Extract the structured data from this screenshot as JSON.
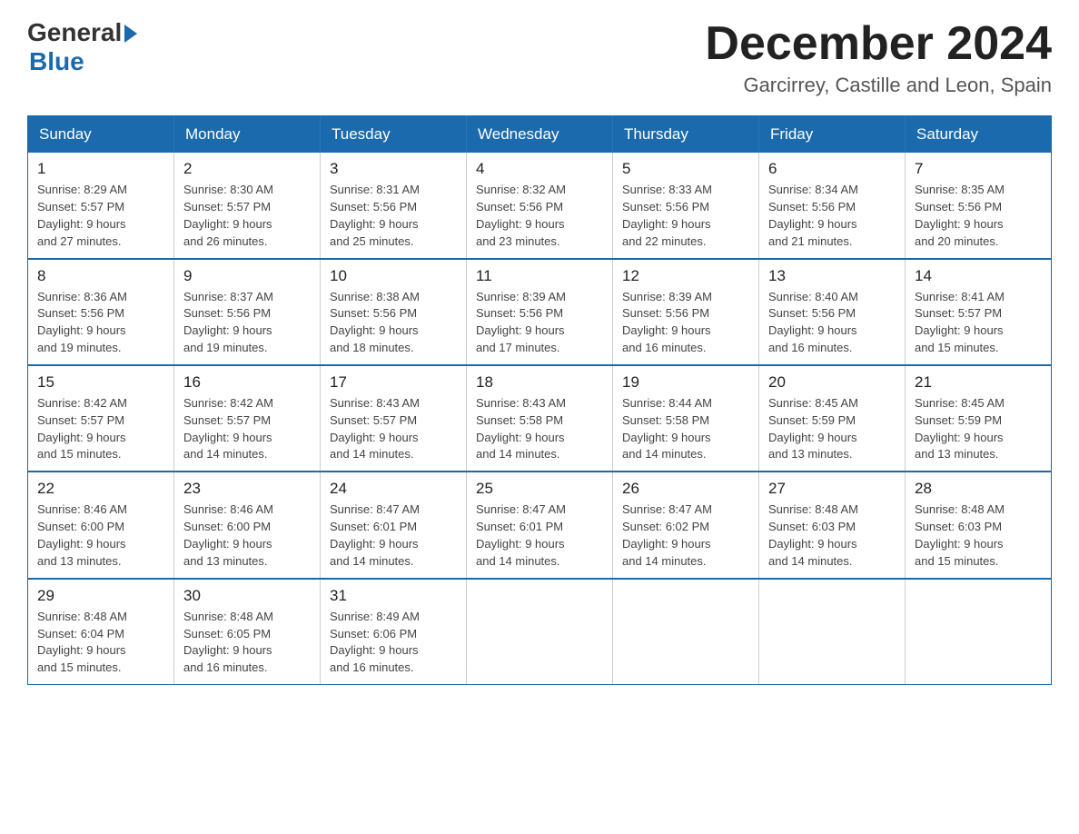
{
  "header": {
    "logo_general": "General",
    "logo_blue": "Blue",
    "month_title": "December 2024",
    "location": "Garcirrey, Castille and Leon, Spain"
  },
  "weekdays": [
    "Sunday",
    "Monday",
    "Tuesday",
    "Wednesday",
    "Thursday",
    "Friday",
    "Saturday"
  ],
  "weeks": [
    [
      {
        "day": "1",
        "sunrise": "8:29 AM",
        "sunset": "5:57 PM",
        "daylight": "9 hours and 27 minutes."
      },
      {
        "day": "2",
        "sunrise": "8:30 AM",
        "sunset": "5:57 PM",
        "daylight": "9 hours and 26 minutes."
      },
      {
        "day": "3",
        "sunrise": "8:31 AM",
        "sunset": "5:56 PM",
        "daylight": "9 hours and 25 minutes."
      },
      {
        "day": "4",
        "sunrise": "8:32 AM",
        "sunset": "5:56 PM",
        "daylight": "9 hours and 23 minutes."
      },
      {
        "day": "5",
        "sunrise": "8:33 AM",
        "sunset": "5:56 PM",
        "daylight": "9 hours and 22 minutes."
      },
      {
        "day": "6",
        "sunrise": "8:34 AM",
        "sunset": "5:56 PM",
        "daylight": "9 hours and 21 minutes."
      },
      {
        "day": "7",
        "sunrise": "8:35 AM",
        "sunset": "5:56 PM",
        "daylight": "9 hours and 20 minutes."
      }
    ],
    [
      {
        "day": "8",
        "sunrise": "8:36 AM",
        "sunset": "5:56 PM",
        "daylight": "9 hours and 19 minutes."
      },
      {
        "day": "9",
        "sunrise": "8:37 AM",
        "sunset": "5:56 PM",
        "daylight": "9 hours and 19 minutes."
      },
      {
        "day": "10",
        "sunrise": "8:38 AM",
        "sunset": "5:56 PM",
        "daylight": "9 hours and 18 minutes."
      },
      {
        "day": "11",
        "sunrise": "8:39 AM",
        "sunset": "5:56 PM",
        "daylight": "9 hours and 17 minutes."
      },
      {
        "day": "12",
        "sunrise": "8:39 AM",
        "sunset": "5:56 PM",
        "daylight": "9 hours and 16 minutes."
      },
      {
        "day": "13",
        "sunrise": "8:40 AM",
        "sunset": "5:56 PM",
        "daylight": "9 hours and 16 minutes."
      },
      {
        "day": "14",
        "sunrise": "8:41 AM",
        "sunset": "5:57 PM",
        "daylight": "9 hours and 15 minutes."
      }
    ],
    [
      {
        "day": "15",
        "sunrise": "8:42 AM",
        "sunset": "5:57 PM",
        "daylight": "9 hours and 15 minutes."
      },
      {
        "day": "16",
        "sunrise": "8:42 AM",
        "sunset": "5:57 PM",
        "daylight": "9 hours and 14 minutes."
      },
      {
        "day": "17",
        "sunrise": "8:43 AM",
        "sunset": "5:57 PM",
        "daylight": "9 hours and 14 minutes."
      },
      {
        "day": "18",
        "sunrise": "8:43 AM",
        "sunset": "5:58 PM",
        "daylight": "9 hours and 14 minutes."
      },
      {
        "day": "19",
        "sunrise": "8:44 AM",
        "sunset": "5:58 PM",
        "daylight": "9 hours and 14 minutes."
      },
      {
        "day": "20",
        "sunrise": "8:45 AM",
        "sunset": "5:59 PM",
        "daylight": "9 hours and 13 minutes."
      },
      {
        "day": "21",
        "sunrise": "8:45 AM",
        "sunset": "5:59 PM",
        "daylight": "9 hours and 13 minutes."
      }
    ],
    [
      {
        "day": "22",
        "sunrise": "8:46 AM",
        "sunset": "6:00 PM",
        "daylight": "9 hours and 13 minutes."
      },
      {
        "day": "23",
        "sunrise": "8:46 AM",
        "sunset": "6:00 PM",
        "daylight": "9 hours and 13 minutes."
      },
      {
        "day": "24",
        "sunrise": "8:47 AM",
        "sunset": "6:01 PM",
        "daylight": "9 hours and 14 minutes."
      },
      {
        "day": "25",
        "sunrise": "8:47 AM",
        "sunset": "6:01 PM",
        "daylight": "9 hours and 14 minutes."
      },
      {
        "day": "26",
        "sunrise": "8:47 AM",
        "sunset": "6:02 PM",
        "daylight": "9 hours and 14 minutes."
      },
      {
        "day": "27",
        "sunrise": "8:48 AM",
        "sunset": "6:03 PM",
        "daylight": "9 hours and 14 minutes."
      },
      {
        "day": "28",
        "sunrise": "8:48 AM",
        "sunset": "6:03 PM",
        "daylight": "9 hours and 15 minutes."
      }
    ],
    [
      {
        "day": "29",
        "sunrise": "8:48 AM",
        "sunset": "6:04 PM",
        "daylight": "9 hours and 15 minutes."
      },
      {
        "day": "30",
        "sunrise": "8:48 AM",
        "sunset": "6:05 PM",
        "daylight": "9 hours and 16 minutes."
      },
      {
        "day": "31",
        "sunrise": "8:49 AM",
        "sunset": "6:06 PM",
        "daylight": "9 hours and 16 minutes."
      },
      null,
      null,
      null,
      null
    ]
  ],
  "labels": {
    "sunrise": "Sunrise:",
    "sunset": "Sunset:",
    "daylight": "Daylight:"
  }
}
